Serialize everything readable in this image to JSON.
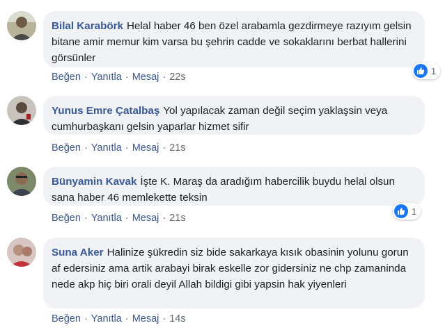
{
  "comments": [
    {
      "author": "Bilal Karabörk",
      "text": "Helal haber 46 ben özel arabamla gezdirmeye razıyım gelsin bitane amir memur kim varsa bu şehrin cadde ve sokaklarını berbat hallerini görsünler",
      "like_label": "Beğen",
      "reply_label": "Yanıtla",
      "message_label": "Mesaj",
      "time": "22s",
      "reaction_count": "1"
    },
    {
      "author": "Yunus Emre Çatalbaş",
      "text": "Yol yapılacak zaman değil seçim yaklaşsin veya cumhurbaşkanı gelsin yaparlar hizmet sifir",
      "like_label": "Beğen",
      "reply_label": "Yanıtla",
      "message_label": "Mesaj",
      "time": "21s",
      "reaction_count": ""
    },
    {
      "author": "Bünyamin Kavak",
      "text": "İşte K. Maraş da aradığım habercilik buydu helal olsun sana haber 46 memlekette teksin",
      "like_label": "Beğen",
      "reply_label": "Yanıtla",
      "message_label": "Mesaj",
      "time": "21s",
      "reaction_count": "1"
    },
    {
      "author": "Suna Aker",
      "text": "Halinize şükredin siz bide sakarkaya kısık obasinin yolunu gorun af edersiniz ama artik arabayi birak eskelle zor gidersiniz ne chp zamaninda nede akp hiç biri orali deyil Allah bildigi gibi yapsin hak yiyenleri",
      "like_label": "Beğen",
      "reply_label": "Yanıtla",
      "message_label": "Mesaj",
      "time": "14s",
      "reaction_count": ""
    }
  ],
  "colors": {
    "author": "#385898",
    "bubble": "#f0f2f5",
    "like_icon": "#1877f2"
  },
  "icons": {
    "reaction": "thumbs-up-icon"
  }
}
